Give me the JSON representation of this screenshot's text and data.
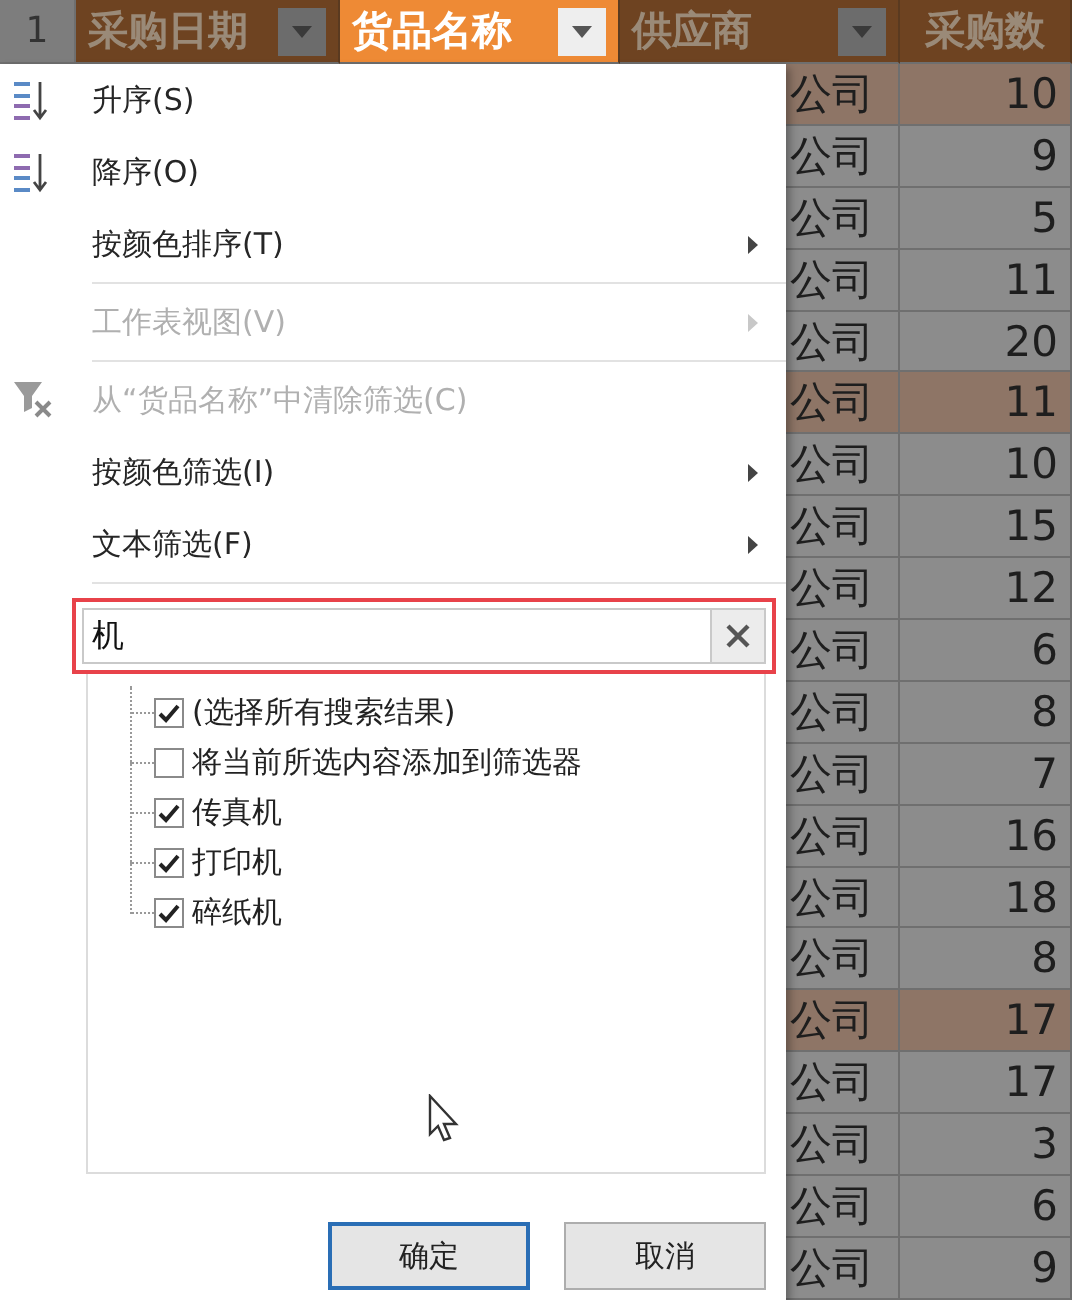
{
  "sheet": {
    "header_row_number": "1",
    "columns": [
      {
        "label": "采购日期",
        "selected": false,
        "filter_button": true
      },
      {
        "label": "货品名称",
        "selected": true,
        "filter_button": true
      },
      {
        "label": "供应商",
        "selected": false,
        "filter_button": true
      },
      {
        "label": "采购数",
        "selected": false,
        "filter_button": false
      }
    ],
    "rows": [
      {
        "supplier": "公司",
        "quantity": "10",
        "shaded": true
      },
      {
        "supplier": "公司",
        "quantity": "9",
        "shaded": false
      },
      {
        "supplier": "公司",
        "quantity": "5",
        "shaded": false
      },
      {
        "supplier": "公司",
        "quantity": "11",
        "shaded": false
      },
      {
        "supplier": "公司",
        "quantity": "20",
        "shaded": false
      },
      {
        "supplier": "公司",
        "quantity": "11",
        "shaded": true
      },
      {
        "supplier": "公司",
        "quantity": "10",
        "shaded": false
      },
      {
        "supplier": "公司",
        "quantity": "15",
        "shaded": false
      },
      {
        "supplier": "公司",
        "quantity": "12",
        "shaded": false
      },
      {
        "supplier": "公司",
        "quantity": "6",
        "shaded": false
      },
      {
        "supplier": "公司",
        "quantity": "8",
        "shaded": false
      },
      {
        "supplier": "公司",
        "quantity": "7",
        "shaded": false
      },
      {
        "supplier": "公司",
        "quantity": "16",
        "shaded": false
      },
      {
        "supplier": "公司",
        "quantity": "18",
        "shaded": false
      },
      {
        "supplier": "公司",
        "quantity": "8",
        "shaded": false
      },
      {
        "supplier": "公司",
        "quantity": "17",
        "shaded": true
      },
      {
        "supplier": "公司",
        "quantity": "17",
        "shaded": false
      },
      {
        "supplier": "公司",
        "quantity": "3",
        "shaded": false
      },
      {
        "supplier": "公司",
        "quantity": "6",
        "shaded": false
      },
      {
        "supplier": "公司",
        "quantity": "9",
        "shaded": false
      }
    ]
  },
  "filter_menu": {
    "items": [
      {
        "kind": "sort-ascending",
        "label": "升序(S)",
        "disabled": false,
        "submenu": false
      },
      {
        "kind": "sort-descending",
        "label": "降序(O)",
        "disabled": false,
        "submenu": false
      },
      {
        "kind": "plain",
        "label": "按颜色排序(T)",
        "disabled": false,
        "submenu": true
      },
      {
        "kind": "separator"
      },
      {
        "kind": "plain",
        "label": "工作表视图(V)",
        "disabled": true,
        "submenu": true
      },
      {
        "kind": "separator"
      },
      {
        "kind": "clear-filter",
        "label": "从“货品名称”中清除筛选(C)",
        "disabled": true,
        "submenu": false
      },
      {
        "kind": "plain",
        "label": "按颜色筛选(I)",
        "disabled": false,
        "submenu": true
      },
      {
        "kind": "plain",
        "label": "文本筛选(F)",
        "disabled": false,
        "submenu": true
      },
      {
        "kind": "separator"
      }
    ],
    "search": {
      "value": "机",
      "highlighted": true
    },
    "options": [
      {
        "label": "(选择所有搜索结果)",
        "checked": true
      },
      {
        "label": "将当前所选内容添加到筛选器",
        "checked": false
      },
      {
        "label": "传真机",
        "checked": true
      },
      {
        "label": "打印机",
        "checked": true
      },
      {
        "label": "碎纸机",
        "checked": true
      }
    ],
    "buttons": [
      {
        "label": "确定",
        "focused": true
      },
      {
        "label": "取消",
        "focused": false
      }
    ]
  }
}
